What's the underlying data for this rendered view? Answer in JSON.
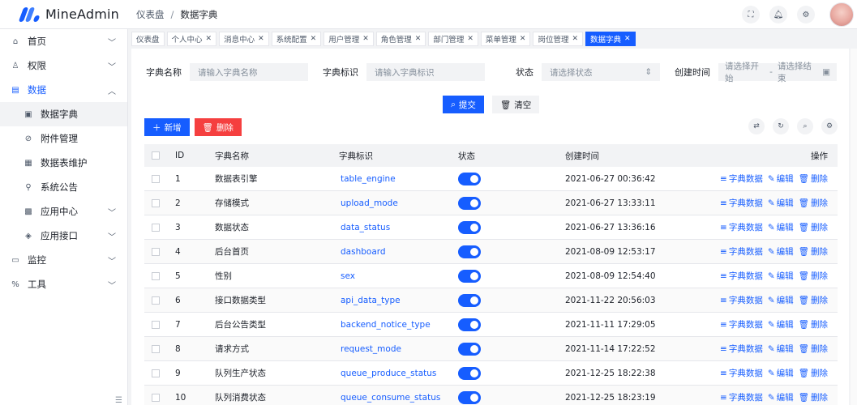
{
  "app": {
    "name": "MineAdmin"
  },
  "breadcrumb": [
    "仪表盘",
    "数据字典"
  ],
  "sidebar": {
    "items": [
      {
        "label": "首页",
        "icon": "home-icon",
        "glyph": "⌂",
        "chevron": true,
        "level": 1
      },
      {
        "label": "权限",
        "icon": "user-lock-icon",
        "glyph": "♙",
        "chevron": true,
        "level": 1
      },
      {
        "label": "数据",
        "icon": "database-icon",
        "glyph": "▤",
        "chevron": true,
        "level": 1,
        "open": true
      },
      {
        "label": "数据字典",
        "icon": "book-icon",
        "glyph": "▣",
        "chevron": false,
        "level": 2,
        "active": true
      },
      {
        "label": "附件管理",
        "icon": "attachment-icon",
        "glyph": "⊘",
        "chevron": false,
        "level": 2
      },
      {
        "label": "数据表维护",
        "icon": "table-icon",
        "glyph": "▦",
        "chevron": false,
        "level": 2
      },
      {
        "label": "系统公告",
        "icon": "bulb-icon",
        "glyph": "⚲",
        "chevron": false,
        "level": 2
      },
      {
        "label": "应用中心",
        "icon": "apps-icon",
        "glyph": "▩",
        "chevron": true,
        "level": 2
      },
      {
        "label": "应用接口",
        "icon": "cube-icon",
        "glyph": "◈",
        "chevron": true,
        "level": 2
      },
      {
        "label": "监控",
        "icon": "monitor-icon",
        "glyph": "▭",
        "chevron": true,
        "level": 1
      },
      {
        "label": "工具",
        "icon": "tool-icon",
        "glyph": "%",
        "chevron": true,
        "level": 1
      }
    ]
  },
  "tabs": [
    {
      "label": "仪表盘",
      "closable": false
    },
    {
      "label": "个人中心",
      "closable": true
    },
    {
      "label": "消息中心",
      "closable": true
    },
    {
      "label": "系统配置",
      "closable": true
    },
    {
      "label": "用户管理",
      "closable": true
    },
    {
      "label": "角色管理",
      "closable": true
    },
    {
      "label": "部门管理",
      "closable": true
    },
    {
      "label": "菜单管理",
      "closable": true
    },
    {
      "label": "岗位管理",
      "closable": true
    },
    {
      "label": "数据字典",
      "closable": true,
      "active": true
    }
  ],
  "search": {
    "name_label": "字典名称",
    "name_placeholder": "请输入字典名称",
    "code_label": "字典标识",
    "code_placeholder": "请输入字典标识",
    "status_label": "状态",
    "status_placeholder": "请选择状态",
    "time_label": "创建时间",
    "time_start": "请选择开始",
    "time_sep": "-",
    "time_end": "请选择结束",
    "submit": "提交",
    "clear": "清空"
  },
  "toolbar": {
    "add": "新增",
    "delete": "删除"
  },
  "table": {
    "headers": {
      "id": "ID",
      "name": "字典名称",
      "code": "字典标识",
      "status": "状态",
      "time": "创建时间",
      "ops": "操作"
    },
    "op_labels": {
      "dict": "字典数据",
      "edit": "编辑",
      "del": "删除"
    },
    "rows": [
      {
        "id": "1",
        "name": "数据表引擎",
        "code": "table_engine",
        "time": "2021-06-27 00:36:42"
      },
      {
        "id": "2",
        "name": "存储模式",
        "code": "upload_mode",
        "time": "2021-06-27 13:33:11"
      },
      {
        "id": "3",
        "name": "数据状态",
        "code": "data_status",
        "time": "2021-06-27 13:36:16"
      },
      {
        "id": "4",
        "name": "后台首页",
        "code": "dashboard",
        "time": "2021-08-09 12:53:17"
      },
      {
        "id": "5",
        "name": "性别",
        "code": "sex",
        "time": "2021-08-09 12:54:40"
      },
      {
        "id": "6",
        "name": "接口数据类型",
        "code": "api_data_type",
        "time": "2021-11-22 20:56:03"
      },
      {
        "id": "7",
        "name": "后台公告类型",
        "code": "backend_notice_type",
        "time": "2021-11-11 17:29:05"
      },
      {
        "id": "8",
        "name": "请求方式",
        "code": "request_mode",
        "time": "2021-11-14 17:22:52"
      },
      {
        "id": "9",
        "name": "队列生产状态",
        "code": "queue_produce_status",
        "time": "2021-12-25 18:22:38"
      },
      {
        "id": "10",
        "name": "队列消费状态",
        "code": "queue_consume_status",
        "time": "2021-12-25 18:23:19"
      }
    ]
  },
  "colors": {
    "primary": "#165dff",
    "danger": "#f53f3f",
    "bg": "#f2f3f5"
  }
}
